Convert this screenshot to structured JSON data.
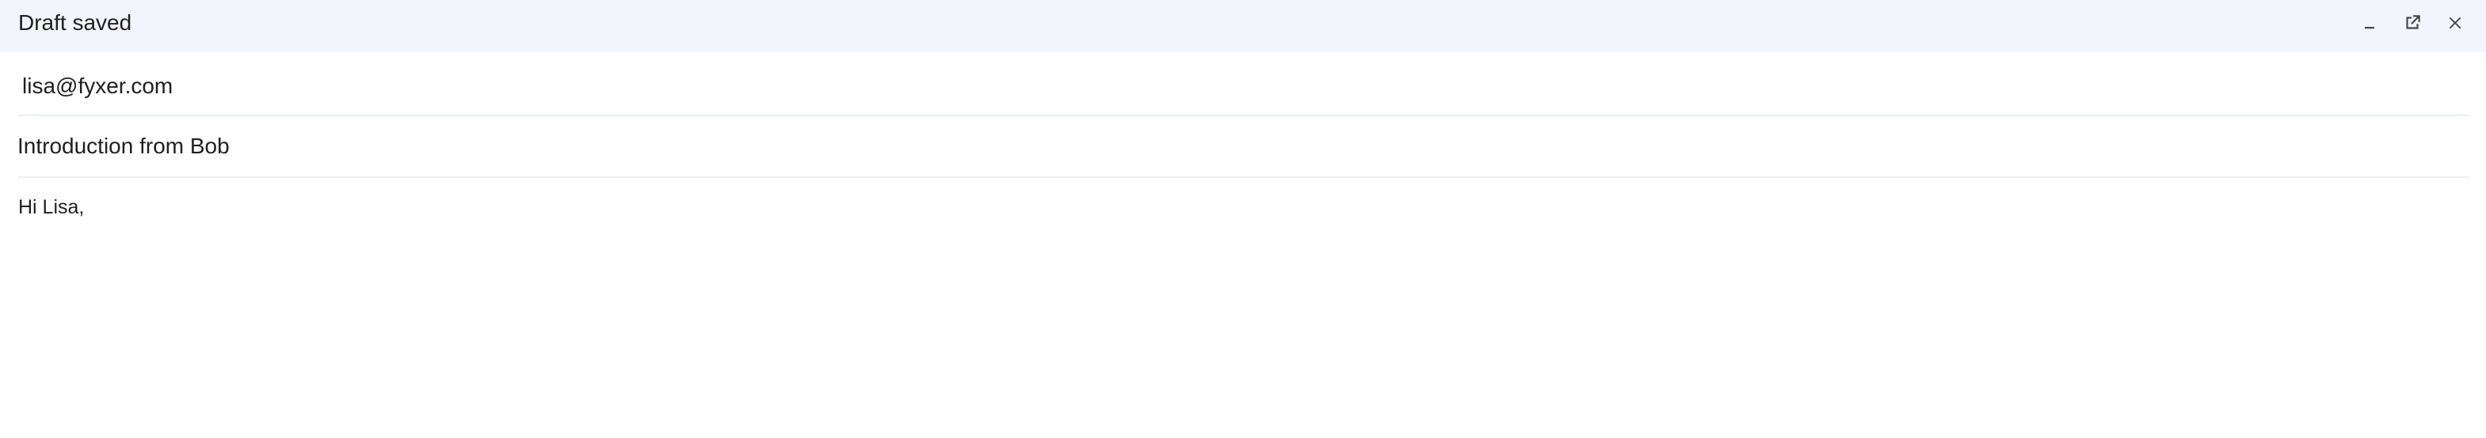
{
  "header": {
    "title": "Draft saved",
    "actions": [
      {
        "name": "minimize",
        "icon": "minimize-icon"
      },
      {
        "name": "pop-out",
        "icon": "open-in-new-icon"
      },
      {
        "name": "close",
        "icon": "close-icon"
      }
    ],
    "background": "#f2f6fc"
  },
  "to": {
    "value": "lisa@fyxer.com"
  },
  "subject": {
    "value": "Introduction from Bob"
  },
  "body": {
    "text": "Hi Lisa,"
  },
  "colors": {
    "divider": "#eceff1",
    "text": "#1f1f1f"
  }
}
